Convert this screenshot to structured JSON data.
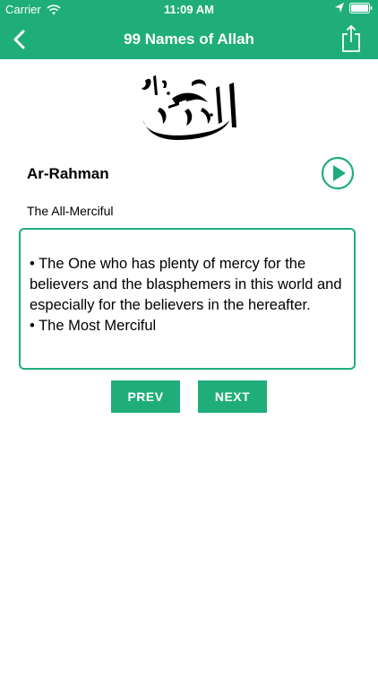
{
  "status": {
    "carrier": "Carrier",
    "time": "11:09 AM"
  },
  "nav": {
    "title": "99 Names of Allah"
  },
  "name": {
    "transliteration": "Ar-Rahman",
    "meaning": "The All-Merciful",
    "description": [
      "• The One who has plenty of mercy for the believers and the blasphemers in this world and especially for the believers in the hereafter.",
      "• The Most Merciful"
    ]
  },
  "buttons": {
    "prev": "PREV",
    "next": "NEXT"
  },
  "colors": {
    "accent": "#1fae7a"
  }
}
